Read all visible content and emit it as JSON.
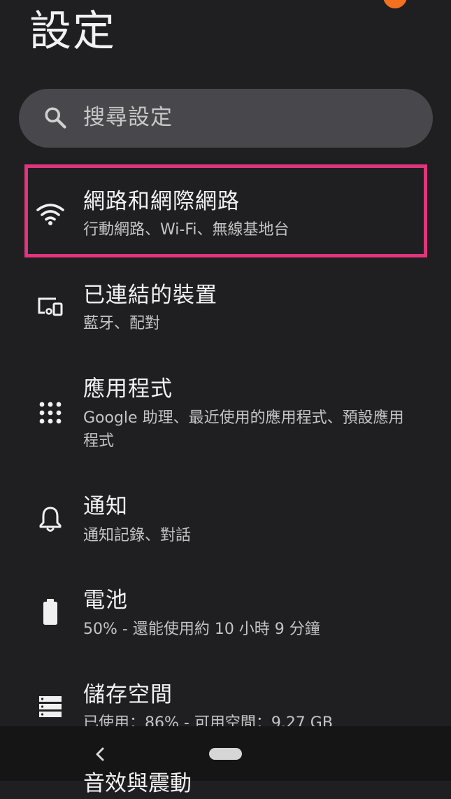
{
  "header": {
    "title": "設定"
  },
  "search": {
    "placeholder": "搜尋設定",
    "icon": "search-icon"
  },
  "colors": {
    "background": "#1f1f21",
    "search_bg": "#48484c",
    "highlight": "#e0357c",
    "status_dot": "#f37021"
  },
  "settings": {
    "items": [
      {
        "title": "網路和網際網路",
        "subtitle": "行動網路、Wi-Fi、無線基地台",
        "icon": "wifi-icon"
      },
      {
        "title": "已連結的裝置",
        "subtitle": "藍牙、配對",
        "icon": "connected-devices-icon"
      },
      {
        "title": "應用程式",
        "subtitle": "Google 助理、最近使用的應用程式、預設應用程式",
        "icon": "apps-grid-icon"
      },
      {
        "title": "通知",
        "subtitle": "通知記錄、對話",
        "icon": "bell-icon"
      },
      {
        "title": "電池",
        "subtitle": "50% - 還能使用約 10 小時 9 分鐘",
        "icon": "battery-icon"
      },
      {
        "title": "儲存空間",
        "subtitle": "已使用：86% - 可用空間：9.27 GB",
        "icon": "storage-icon"
      },
      {
        "title": "音效與震動",
        "subtitle": "",
        "icon": "sound-icon"
      }
    ]
  },
  "navigation": {
    "back_icon": "back-icon",
    "home_icon": "home-pill-icon"
  }
}
